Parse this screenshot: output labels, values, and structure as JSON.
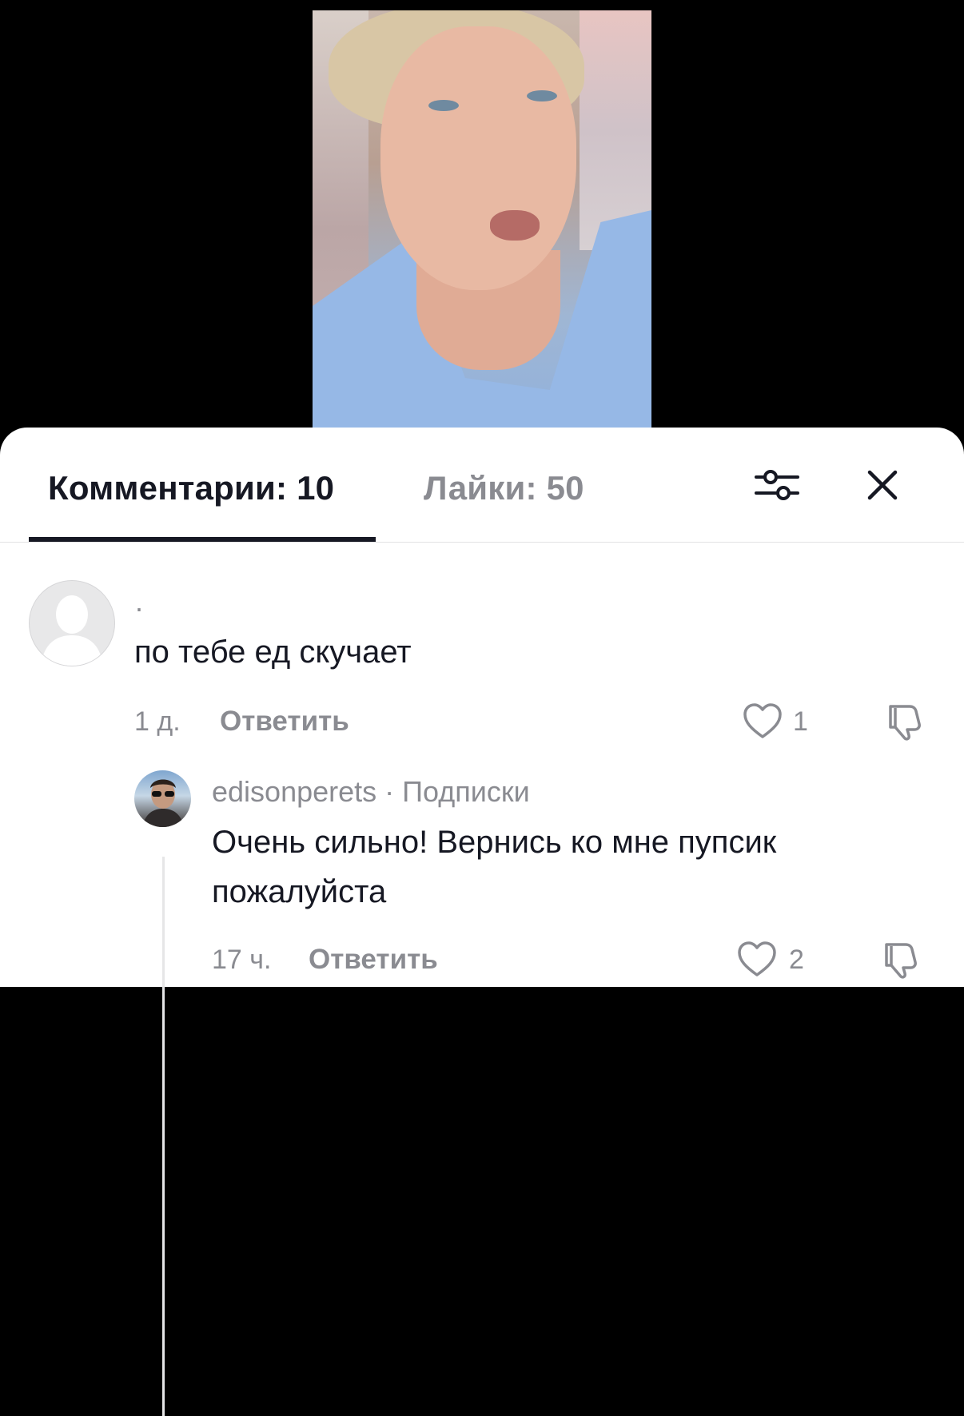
{
  "tabs": {
    "comments_label": "Комментарии: 10",
    "likes_label": "Лайки: 50"
  },
  "icons": {
    "filter": "sliders-icon",
    "close": "close-icon",
    "heart": "heart-icon",
    "dislike": "thumbs-down-icon"
  },
  "comments": [
    {
      "username": "·",
      "text": "по тебе ед скучает",
      "time": "1 д.",
      "reply_label": "Ответить",
      "likes": "1"
    },
    {
      "username": "edisonperets · Подписки",
      "text_line1": "Очень сильно! Вернись ко мне пупсик",
      "text_line2": "пожалуйста",
      "time": "17 ч.",
      "reply_label": "Ответить",
      "likes": "2"
    }
  ],
  "colors": {
    "primary_text": "#161823",
    "secondary_text": "#8a8b91",
    "divider": "#e3e3e4"
  }
}
